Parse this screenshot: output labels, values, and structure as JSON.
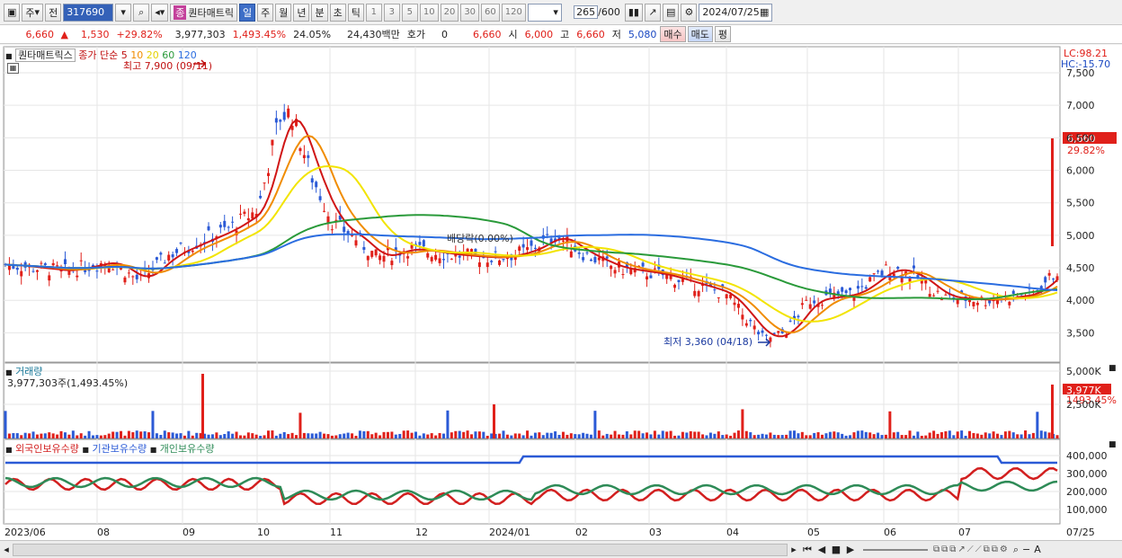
{
  "toolbar": {
    "market": "주",
    "prev": "전",
    "code": "317690",
    "name": "퀀타매트릭",
    "period_tabs": [
      "일",
      "주",
      "월",
      "년",
      "분",
      "초",
      "틱"
    ],
    "period_nums": [
      "1",
      "3",
      "5",
      "10",
      "20",
      "30",
      "60",
      "120"
    ],
    "count": "265",
    "max": "/600",
    "date": "2024/07/25"
  },
  "info": {
    "price": "6,660",
    "change": "1,530",
    "rate": "+29.82%",
    "volume": "3,977,303",
    "vol_rate": "1,493.45%",
    "turnover": "24.05%",
    "amount": "24,430백만",
    "hoga_label": "호가",
    "hoga": "0",
    "ask": "6,660",
    "open_label": "시",
    "open": "6,000",
    "high_label": "고",
    "high": "6,660",
    "low_label": "저",
    "low": "5,080",
    "buy": "매수",
    "sell": "매도",
    "avg": "평"
  },
  "legend": {
    "name": "퀀타매트릭스",
    "ma_label": "종가 단순",
    "ma": [
      "5",
      "10",
      "20",
      "60",
      "120"
    ]
  },
  "annot": {
    "high": "최고 7,900 (09/11)",
    "low": "최저 3,360 (04/18)",
    "div": "배당락(0.00%)"
  },
  "axis": {
    "price_ticks": [
      "7,500",
      "7,000",
      "6,500",
      "6,000",
      "5,500",
      "5,000",
      "4,500",
      "4,000",
      "3,500"
    ],
    "lc": "LC:98.21",
    "hc": "HC:-15.70",
    "current": "6,660",
    "current_rate": "29.82%",
    "vol_ticks": [
      "5,000K",
      "2,500K"
    ],
    "vol_current": "3,977K",
    "vol_rate": "1493.45%",
    "hold_ticks": [
      "400,000",
      "300,000",
      "200,000",
      "100,000"
    ]
  },
  "volume_panel": {
    "title": "거래량",
    "value": "3,977,303주(1,493.45%)"
  },
  "holdings_panel": {
    "series": [
      "외국인보유수량",
      "기관보유수량",
      "개인보유수량"
    ]
  },
  "dates": [
    "2023/06",
    "08",
    "09",
    "10",
    "11",
    "12",
    "2024/01",
    "02",
    "03",
    "04",
    "05",
    "06",
    "07",
    "07/25"
  ]
}
